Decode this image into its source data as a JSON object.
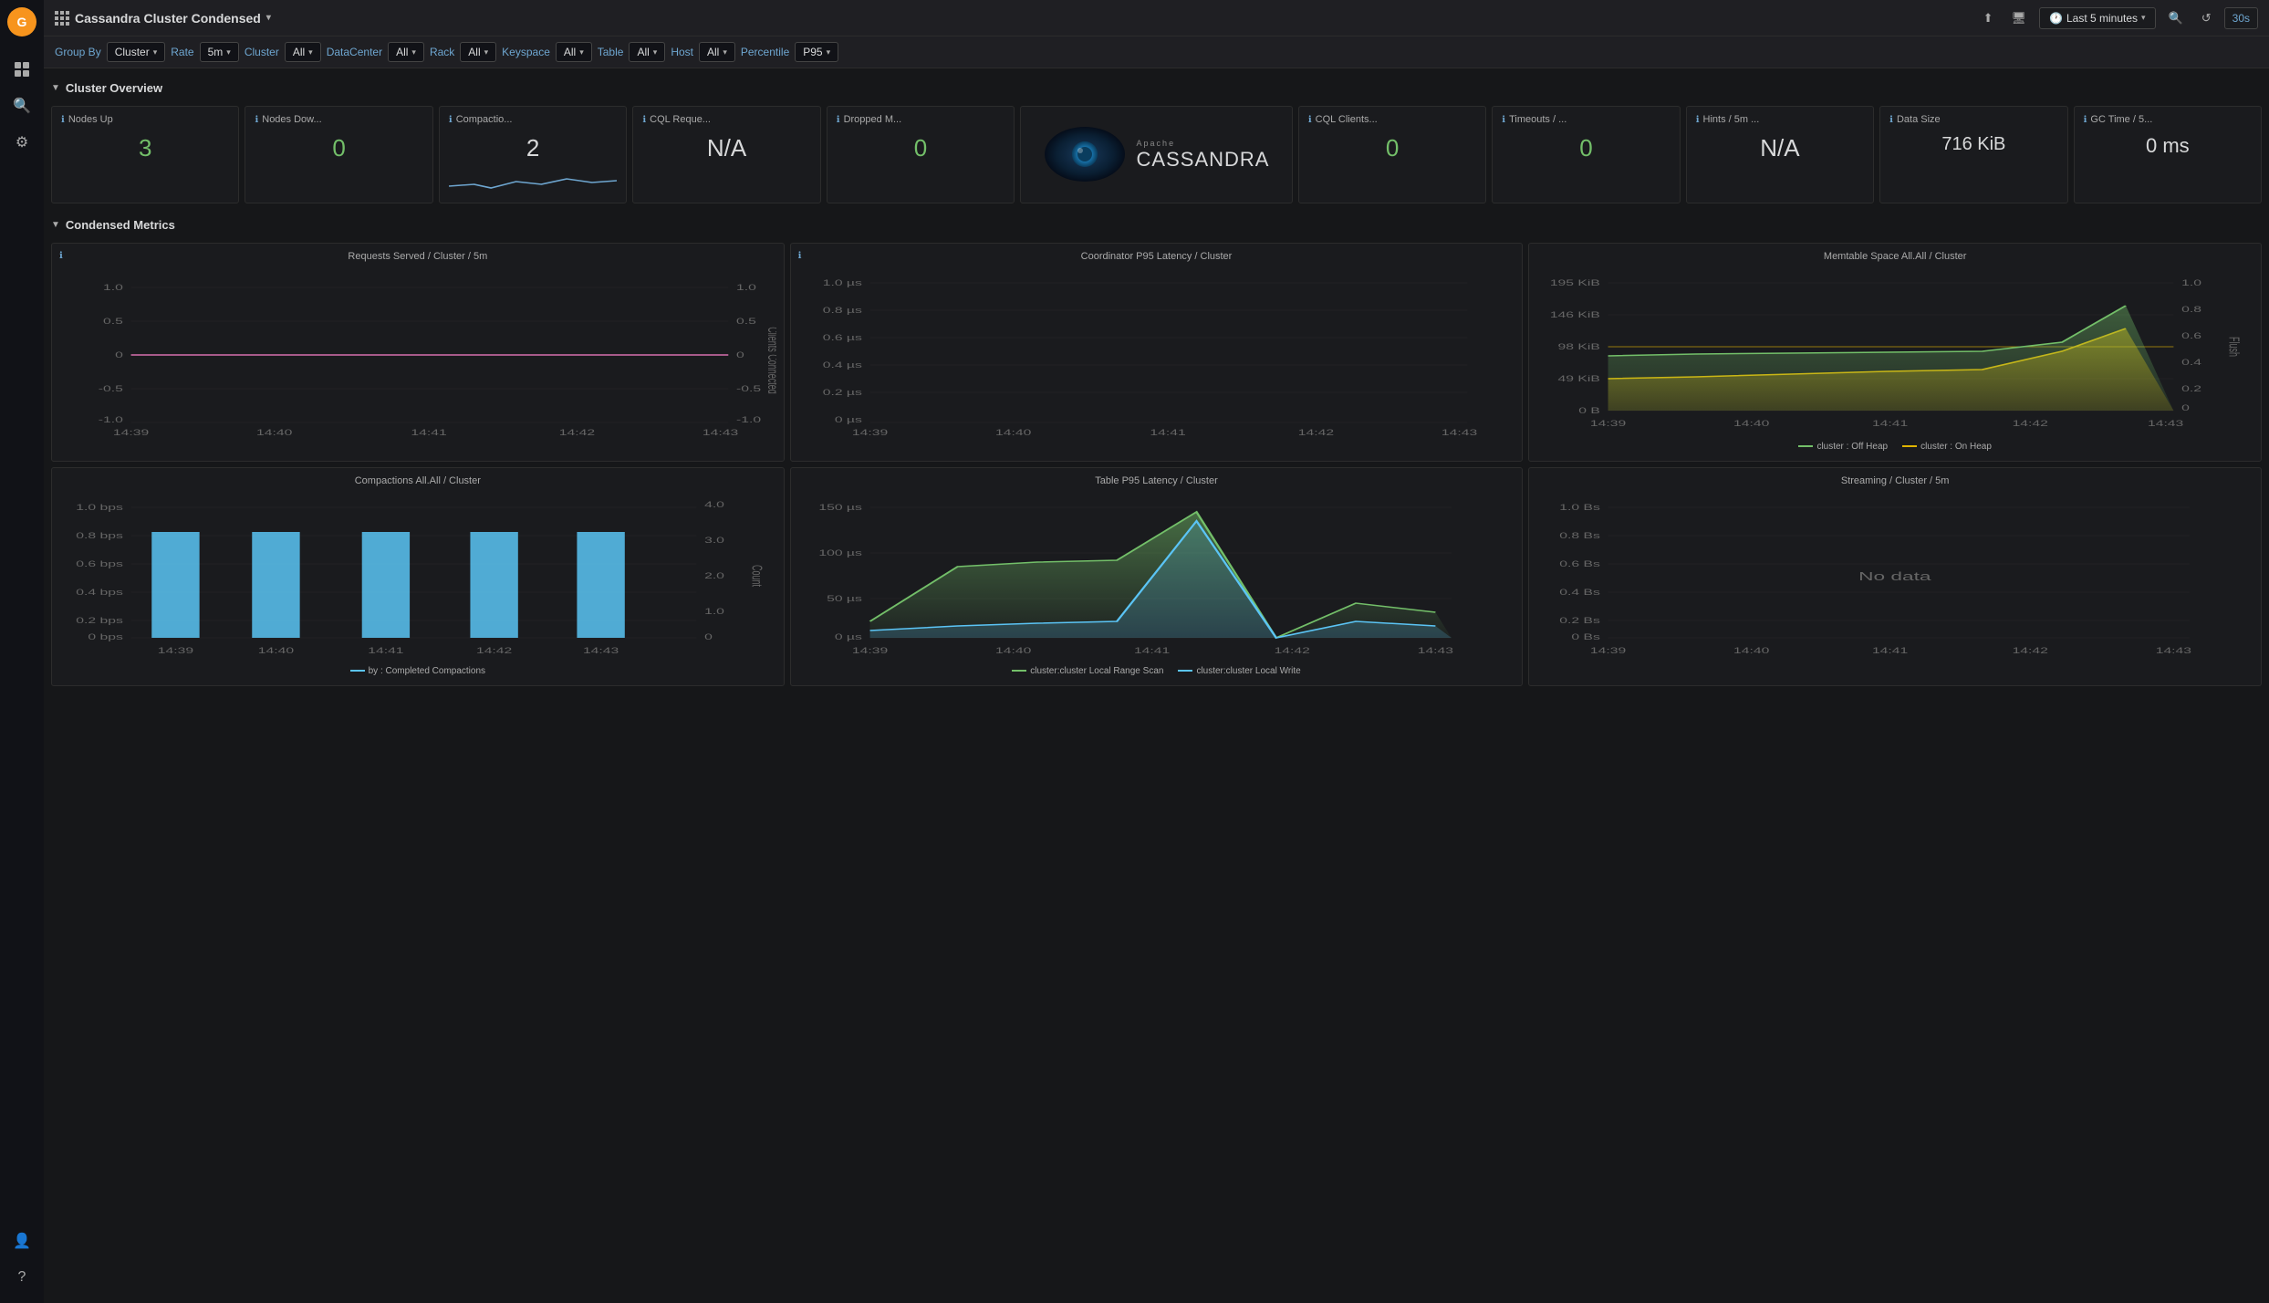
{
  "app": {
    "logo_color": "#f7941d",
    "title": "Cassandra Cluster Condensed",
    "title_arrow": "▾"
  },
  "topbar": {
    "share_label": "⬆",
    "tv_label": "🖥",
    "time_range": "Last 5 minutes",
    "time_range_arrow": "▾",
    "search_label": "🔍",
    "refresh_label": "↺",
    "refresh_value": "30s"
  },
  "filters": [
    {
      "label": "Group By",
      "value": "Cluster",
      "has_dropdown": true
    },
    {
      "label": "Rate",
      "value": "5m",
      "has_dropdown": true
    },
    {
      "label": "Cluster",
      "value": "All",
      "has_dropdown": true
    },
    {
      "label": "DataCenter",
      "value": "All",
      "has_dropdown": true
    },
    {
      "label": "Rack",
      "value": "All",
      "has_dropdown": true
    },
    {
      "label": "Keyspace",
      "value": "All",
      "has_dropdown": true
    },
    {
      "label": "Table",
      "value": "All",
      "has_dropdown": true
    },
    {
      "label": "Host",
      "value": "All",
      "has_dropdown": true
    },
    {
      "label": "Percentile",
      "value": "P95",
      "has_dropdown": true
    }
  ],
  "sections": {
    "cluster_overview": {
      "title": "Cluster Overview",
      "stats": [
        {
          "title": "Nodes Up",
          "value": "3",
          "value_class": "val-green",
          "type": "number"
        },
        {
          "title": "Nodes Dow...",
          "value": "0",
          "value_class": "val-green",
          "type": "number"
        },
        {
          "title": "Compactio...",
          "value": "2",
          "value_class": "val-white",
          "type": "sparkline"
        },
        {
          "title": "CQL Reque...",
          "value": "N/A",
          "value_class": "val-white",
          "type": "number"
        },
        {
          "title": "Dropped M...",
          "value": "0",
          "value_class": "val-green",
          "type": "number"
        },
        {
          "title": "cassandra_logo",
          "type": "logo"
        },
        {
          "title": "CQL Clients...",
          "value": "0",
          "value_class": "val-green",
          "type": "number"
        },
        {
          "title": "Timeouts / ...",
          "value": "0",
          "value_class": "val-green",
          "type": "number"
        },
        {
          "title": "Hints / 5m ...",
          "value": "N/A",
          "value_class": "val-white",
          "type": "number"
        },
        {
          "title": "Data Size",
          "value": "716 KiB",
          "value_class": "val-white",
          "type": "number"
        },
        {
          "title": "GC Time / 5...",
          "value": "0 ms",
          "value_class": "val-white",
          "type": "number"
        }
      ]
    },
    "condensed_metrics": {
      "title": "Condensed Metrics",
      "charts": [
        {
          "title": "Requests Served / Cluster / 5m",
          "type": "line_dual",
          "y_left_labels": [
            "1.0",
            "0.5",
            "0",
            "-0.5",
            "-1.0"
          ],
          "y_right_labels": [
            "1.0",
            "0.5",
            "0",
            "-0.5",
            "-1.0"
          ],
          "x_labels": [
            "14:39",
            "14:40",
            "14:41",
            "14:42",
            "14:43"
          ],
          "right_axis_label": "Clients Connected"
        },
        {
          "title": "Coordinator P95 Latency / Cluster",
          "type": "line",
          "y_labels": [
            "1.0 µs",
            "0.8 µs",
            "0.6 µs",
            "0.4 µs",
            "0.2 µs",
            "0 µs"
          ],
          "x_labels": [
            "14:39",
            "14:40",
            "14:41",
            "14:42",
            "14:43"
          ]
        },
        {
          "title": "Memtable Space All.All / Cluster",
          "type": "area_dual",
          "y_left_labels": [
            "195 KiB",
            "146 KiB",
            "98 KiB",
            "49 KiB",
            "0 B"
          ],
          "y_right_labels": [
            "1.0",
            "0.8",
            "0.6",
            "0.4",
            "0.2",
            "0"
          ],
          "x_labels": [
            "14:39",
            "14:40",
            "14:41",
            "14:42",
            "14:43"
          ],
          "right_axis_label": "Flush",
          "legend": [
            {
              "label": "cluster : Off Heap",
              "color": "#73bf69"
            },
            {
              "label": "cluster : On Heap",
              "color": "#e0b400"
            }
          ]
        },
        {
          "title": "Compactions All.All / Cluster",
          "type": "bar_line",
          "y_left_labels": [
            "1.0 bps",
            "0.8 bps",
            "0.6 bps",
            "0.4 bps",
            "0.2 bps",
            "0 bps"
          ],
          "y_right_labels": [
            "4.0",
            "3.0",
            "2.0",
            "1.0",
            "0"
          ],
          "x_labels": [
            "14:39",
            "14:40",
            "14:41",
            "14:42",
            "14:43"
          ],
          "right_axis_label": "Count",
          "legend": [
            {
              "label": "by : Completed Compactions",
              "color": "#5bc4f5"
            }
          ]
        },
        {
          "title": "Table P95 Latency / Cluster",
          "type": "area",
          "y_labels": [
            "150 µs",
            "100 µs",
            "50 µs",
            "0 µs"
          ],
          "x_labels": [
            "14:39",
            "14:40",
            "14:41",
            "14:42",
            "14:43"
          ],
          "legend": [
            {
              "label": "cluster:cluster Local Range Scan",
              "color": "#73bf69"
            },
            {
              "label": "cluster:cluster Local Write",
              "color": "#5bc4f5"
            }
          ]
        },
        {
          "title": "Streaming / Cluster / 5m",
          "type": "empty",
          "y_labels": [
            "1.0 Bs",
            "0.8 Bs",
            "0.6 Bs",
            "0.4 Bs",
            "0.2 Bs",
            "0 Bs"
          ],
          "x_labels": [
            "14:39",
            "14:40",
            "14:41",
            "14:42",
            "14:43"
          ],
          "no_data_label": "No data"
        }
      ]
    }
  }
}
